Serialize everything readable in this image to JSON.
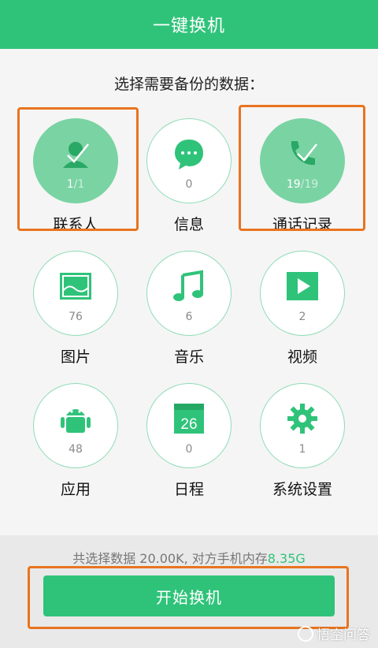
{
  "header": {
    "title": "一键换机"
  },
  "prompt": "选择需要备份的数据：",
  "categories": [
    {
      "label": "联系人",
      "count_sel": "1",
      "count_total": "/1",
      "icon": "contact-icon",
      "selected": true
    },
    {
      "label": "信息",
      "count": "0",
      "icon": "message-icon",
      "selected": false
    },
    {
      "label": "通话记录",
      "count_sel": "19",
      "count_total": "/19",
      "icon": "phone-icon",
      "selected": true
    },
    {
      "label": "图片",
      "count": "76",
      "icon": "image-icon",
      "selected": false
    },
    {
      "label": "音乐",
      "count": "6",
      "icon": "music-icon",
      "selected": false
    },
    {
      "label": "视频",
      "count": "2",
      "icon": "video-icon",
      "selected": false
    },
    {
      "label": "应用",
      "count": "48",
      "icon": "android-icon",
      "selected": false
    },
    {
      "label": "日程",
      "count": "0",
      "calendar_day": "26",
      "icon": "calendar-icon",
      "selected": false
    },
    {
      "label": "系统设置",
      "count": "1",
      "icon": "gear-icon",
      "selected": false
    }
  ],
  "summary": {
    "prefix": "共选择数据 20.00K, 对方手机内存",
    "free": "8.35G"
  },
  "start_button": "开始换机",
  "watermark": "悟空问答",
  "colors": {
    "accent": "#2fc37a",
    "selected_fill": "#7ad3a3",
    "highlight": "#e8741f"
  }
}
